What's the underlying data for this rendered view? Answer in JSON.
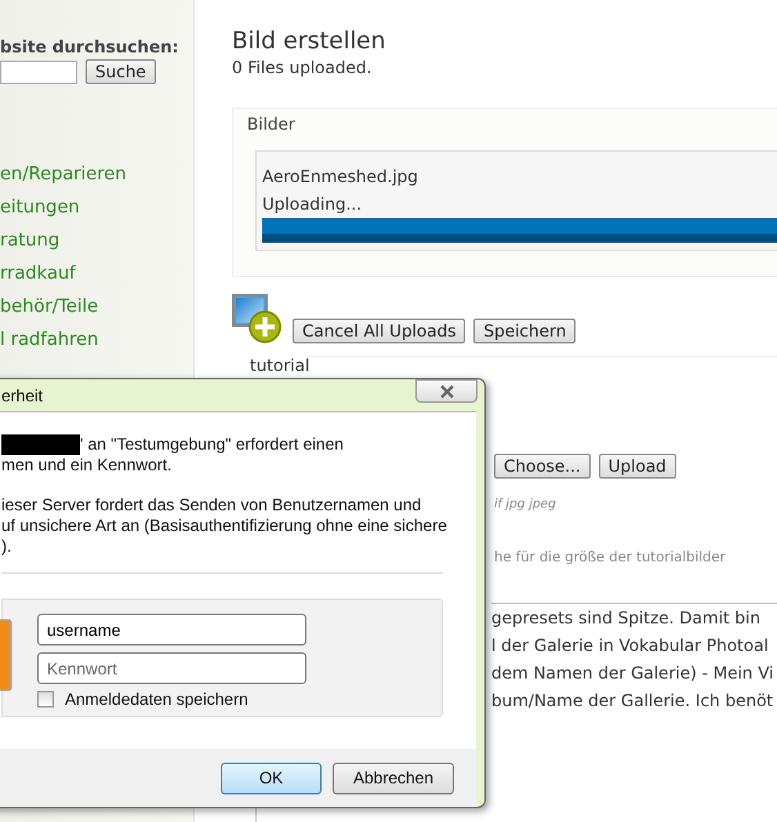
{
  "sidebar": {
    "search_label": "bsite durchsuchen:",
    "search_button": "Suche",
    "links": [
      "en/Reparieren",
      "eitungen",
      "ratung",
      "rradkauf",
      "behör/Teile",
      "l radfahren"
    ]
  },
  "main": {
    "title": "Bild erstellen",
    "status": "0 Files uploaded.",
    "bilder": {
      "legend": "Bilder",
      "file": {
        "name": "AeroEnmeshed.jpg",
        "status": "Uploading...",
        "level": 1
      }
    },
    "buttons": [
      "Cancel All Uploads",
      "Speichern"
    ],
    "tutorial": {
      "legend": "tutorial",
      "choose_button": "Choose...",
      "upload_button": "Upload",
      "file_types": "if jpg jpeg",
      "hint": "he für die größe der tutorialbilder",
      "text_lines": [
        "gepresets sind Spitze. Damit bin",
        "l der Galerie in Vokabular Photoal",
        "dem Namen der Galerie) - Mein Vi",
        "bum/Name der Gallerie. Ich benöt"
      ]
    }
  },
  "dialog": {
    "title": "erheit",
    "message_lines": [
      "' an \"Testumgebung\" erfordert einen",
      "men und ein Kennwort."
    ],
    "warning_lines": [
      "ieser Server fordert das Senden von Benutzernamen und",
      "uf unsichere Art an (Basisauthentifizierung ohne eine sichere",
      ")."
    ],
    "username": {
      "value": "username"
    },
    "password": {
      "placeholder": "Kennwort"
    },
    "remember": {
      "label": "Anmeldedaten speichern",
      "checked": false
    },
    "buttons": [
      {
        "label": "OK",
        "default": true
      },
      {
        "label": "Abbrechen",
        "default": false
      }
    ]
  }
}
